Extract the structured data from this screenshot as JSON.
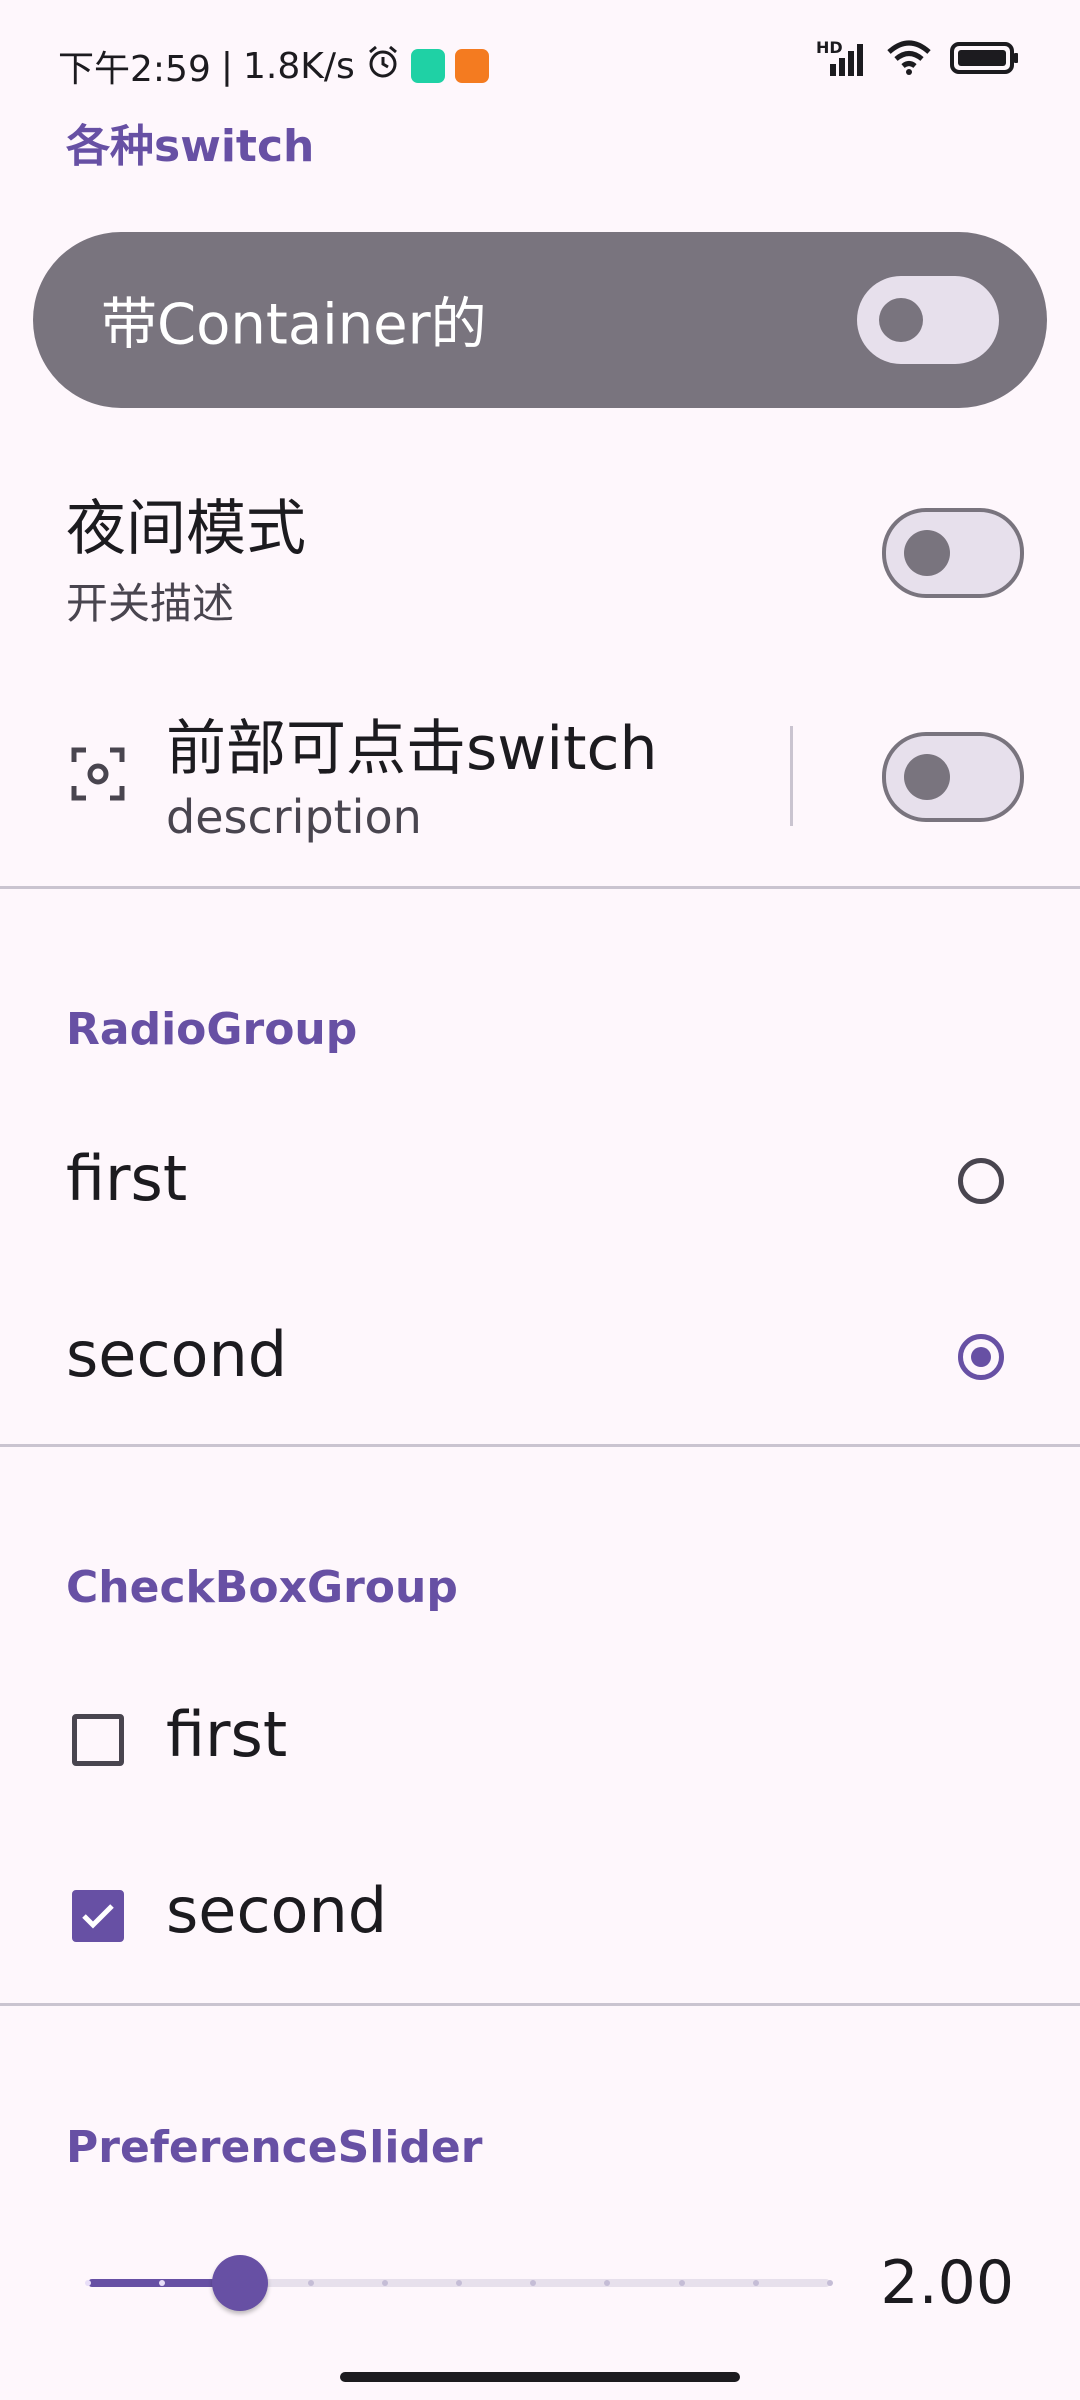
{
  "status_bar": {
    "time": "下午2:59",
    "separator": "|",
    "net_speed": "1.8K/s",
    "alarm_icon": "alarm-icon",
    "app_icon_1_color": "#1fd1a5",
    "app_icon_2_color": "#f47b20",
    "hd_label": "HD"
  },
  "switch_section": {
    "title": "各种switch",
    "container_item": {
      "label": "带Container的",
      "checked": false
    },
    "night_mode": {
      "title": "夜间模式",
      "description": "开关描述",
      "checked": false
    },
    "front_click": {
      "title": "前部可点击switch",
      "description": "description",
      "icon": "center-focus-icon",
      "checked": false
    }
  },
  "radio_section": {
    "title": "RadioGroup",
    "options": [
      {
        "label": "first",
        "selected": false
      },
      {
        "label": "second",
        "selected": true
      }
    ]
  },
  "checkbox_section": {
    "title": "CheckBoxGroup",
    "options": [
      {
        "label": "first",
        "checked": false
      },
      {
        "label": "second",
        "checked": true
      }
    ]
  },
  "slider_section": {
    "title": "PreferenceSlider",
    "value_text": "2.00",
    "value": 2,
    "min": 0,
    "max": 10,
    "steps": 10
  },
  "colors": {
    "primary": "#6750a4",
    "background": "#fef7fc",
    "outline": "#79747e"
  }
}
